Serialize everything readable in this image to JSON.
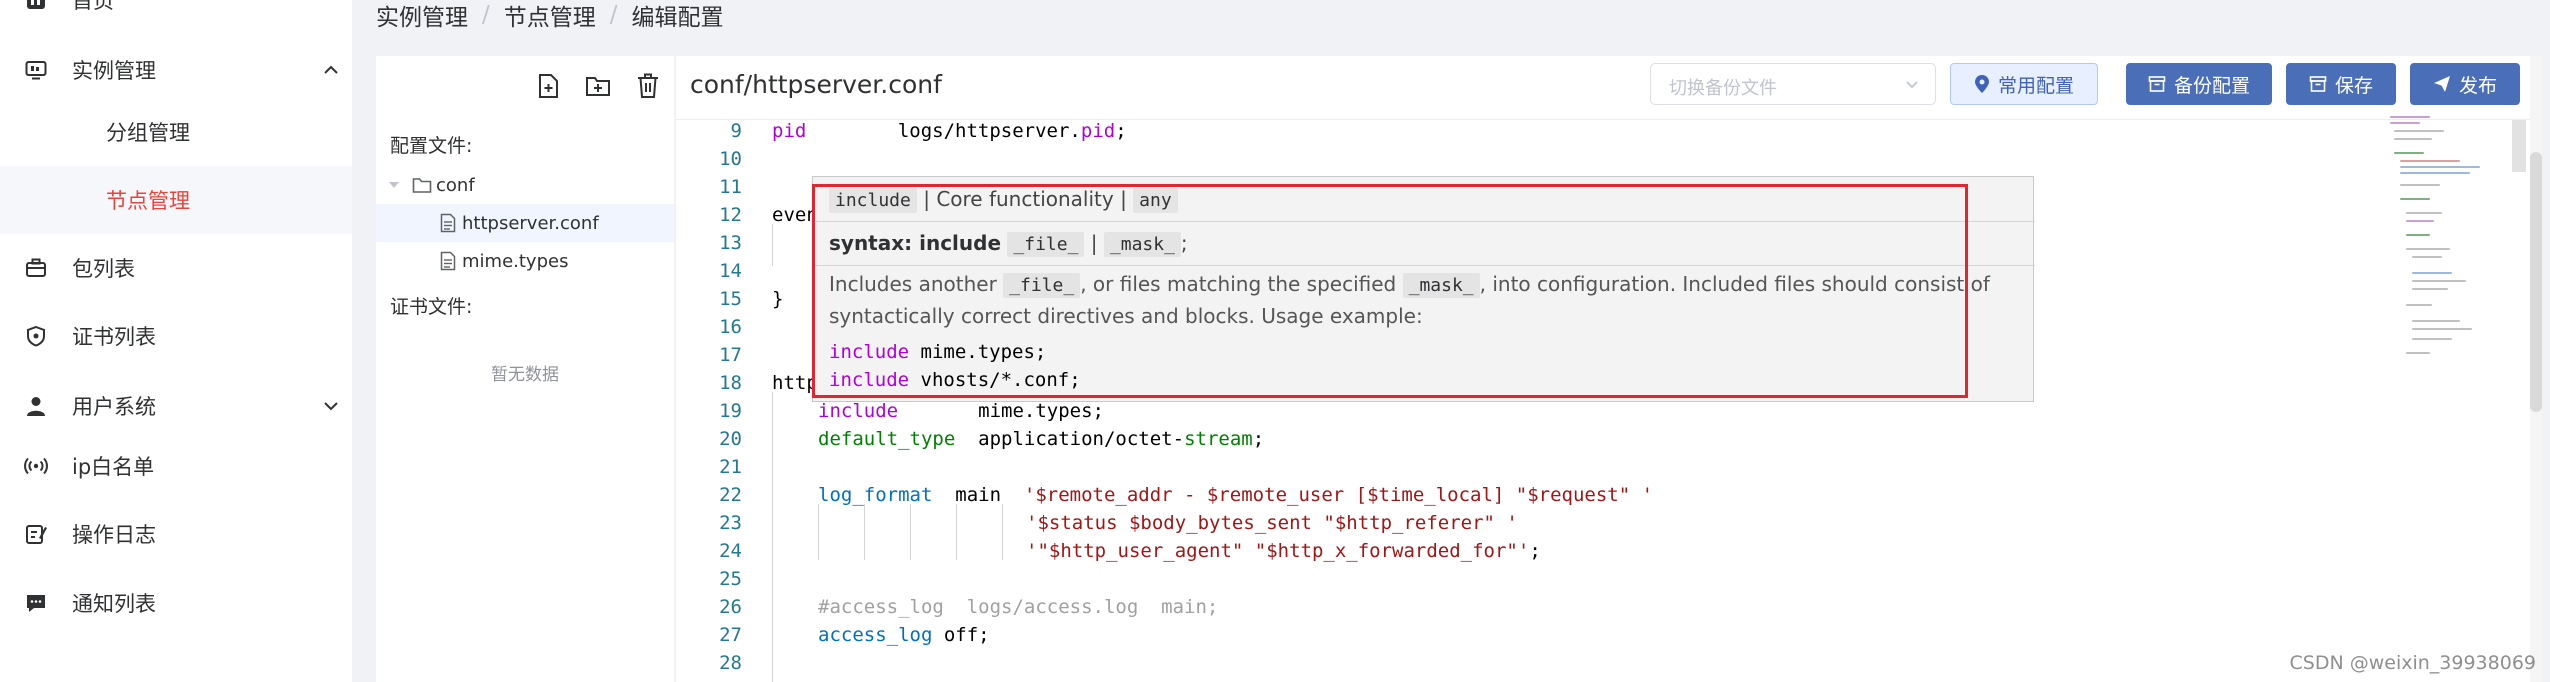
{
  "nav": {
    "home": "首页",
    "instance_mgmt": "实例管理",
    "group_mgmt": "分组管理",
    "node_mgmt": "节点管理",
    "package_list": "包列表",
    "cert_list": "证书列表",
    "user_system": "用户系统",
    "ip_whitelist": "ip白名单",
    "op_log": "操作日志",
    "notify_list": "通知列表"
  },
  "breadcrumb": {
    "level1": "实例管理",
    "level2": "节点管理",
    "level3": "编辑配置",
    "separator": "/"
  },
  "files": {
    "config_heading": "配置文件:",
    "folder": "conf",
    "file1": "httpserver.conf",
    "file2": "mime.types",
    "cert_heading": "证书文件:",
    "empty": "暂无数据"
  },
  "editor": {
    "title": "conf/httpserver.conf",
    "backup_placeholder": "切换备份文件",
    "common_config": "常用配置",
    "backup_config": "备份配置",
    "save": "保存",
    "publish": "发布"
  },
  "code": {
    "l9_num": "9",
    "l9_kw": "pid",
    "l9_rest": "        logs/httpserver.",
    "l9_pid": "pid",
    "l9_end": ";",
    "l10_num": "10",
    "l11_num": "11",
    "l12_num": "12",
    "l12_text": "even",
    "l13_num": "13",
    "l14_num": "14",
    "l15_num": "15",
    "l15_text": "}",
    "l16_num": "16",
    "l17_num": "17",
    "l18_num": "18",
    "l18_text": "http",
    "l19_num": "19",
    "l19_kw": "include",
    "l19_rest": "       mime.types;",
    "l20_num": "20",
    "l20_kw": "default_type",
    "l20_rest": "  application/octet-",
    "l20_stream": "stream",
    "l20_end": ";",
    "l21_num": "21",
    "l22_num": "22",
    "l22_kw": "log_format",
    "l22_mid": "  main  ",
    "l22_a": "'$remote_addr - $remote_user [$time_local] \"$request\" '",
    "l23_num": "23",
    "l23_a": "'$status $body_bytes_sent \"$http_referer\" '",
    "l24_num": "24",
    "l24_a": "'\"$http_user_agent\" \"$http_x_forwarded_for\"'",
    "l24_end": ";",
    "l25_num": "25",
    "l26_num": "26",
    "l26_text": "#access_log  logs/access.log  main;",
    "l27_num": "27",
    "l27_kw": "access_log",
    "l27_rest": " off;",
    "l28_num": "28"
  },
  "tooltip": {
    "name": "include",
    "module": "| Core functionality |",
    "context": "any",
    "syntax_label": "syntax: include",
    "arg_file": "_file_",
    "pipe": "|",
    "arg_mask": "_mask_",
    "semicolon": ";",
    "desc1": "Includes another",
    "desc2": ", or files matching the specified",
    "desc3": ", into configuration. Included files should consist of syntactically correct directives and blocks. Usage example:",
    "ex1_kw": "include",
    "ex1_rest": " mime.types;",
    "ex2_kw": "include",
    "ex2_rest": " vhosts/*.conf;"
  },
  "watermark": "CSDN @weixin_39938069",
  "colors": {
    "accent": "#4a6fb8",
    "active_nav": "#e6453a",
    "highlight_box": "#e0262e"
  }
}
